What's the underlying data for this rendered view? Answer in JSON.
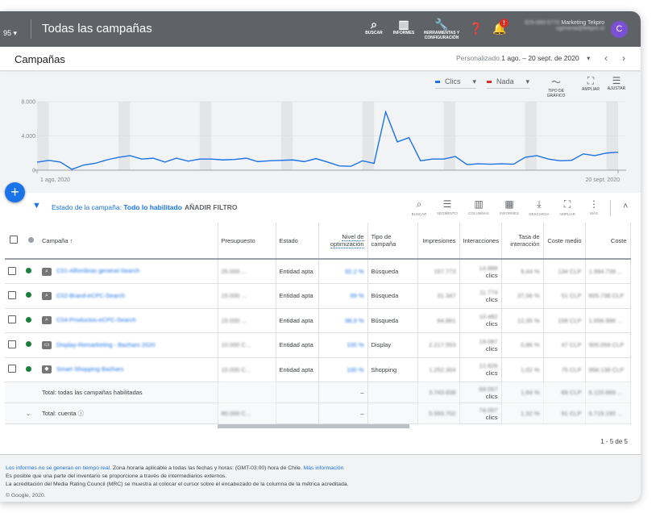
{
  "topbar": {
    "account_fragment": "95",
    "title": "Todas las campañas",
    "search": "BUSCAR",
    "reports": "INFORMES",
    "tools": "HERRAMIENTAS Y CONFIGURACIÓN",
    "notification_badge": "!",
    "phone": "929-069-5770",
    "account_name": "Marketing Tekpro",
    "email": "cgimena@tekpro.cl",
    "avatar": "C"
  },
  "header": {
    "title": "Campañas",
    "range_label": "Personalizado",
    "range": "1 ago. – 20 sept. de 2020"
  },
  "chart_controls": {
    "metric1": "Clics",
    "metric1_color": "#1a73e8",
    "metric2": "Nada",
    "metric2_color": "#d93025",
    "chart_type": "TIPO DE GRÁFICO",
    "expand": "AMPLIAR",
    "adjust": "AJUSTAR"
  },
  "chart_data": {
    "type": "line",
    "x_start": "1 ago. 2020",
    "x_end": "20 sept. 2020",
    "x_tick_labels": [
      "1 ago. 2020",
      "20 sept. 2020"
    ],
    "y_tick_labels": [
      "0",
      "4.000",
      "8.000"
    ],
    "ylim": [
      0,
      8000
    ],
    "grid": true,
    "weekend_shading": true,
    "series": [
      {
        "name": "Clics",
        "color": "#1a73e8",
        "values": [
          940,
          1150,
          950,
          100,
          600,
          800,
          1200,
          1500,
          1700,
          1300,
          1400,
          950,
          1400,
          1050,
          1300,
          1300,
          1200,
          1250,
          1400,
          1000,
          1100,
          1150,
          1200,
          1000,
          1350,
          950,
          500,
          450,
          1100,
          800,
          6800,
          3300,
          3800,
          1100,
          1300,
          1300,
          1600,
          650,
          750,
          700,
          750,
          700,
          1500,
          1700,
          1300,
          1100,
          1150,
          1900,
          1700,
          2000,
          2100
        ]
      }
    ]
  },
  "filter": {
    "label": "Estado de la campaña:",
    "value": "Todo lo habilitado",
    "add": "AÑADIR FILTRO"
  },
  "table_tools": [
    "BUSCAR",
    "SEGMENTO",
    "COLUMNAS",
    "INFORMES",
    "DESCARGA",
    "AMPLIAR",
    "MÁS"
  ],
  "columns": [
    "Campaña",
    "Presupuesto",
    "Estado",
    "Nivel de optimización",
    "Tipo de campaña",
    "Impresiones",
    "Interacciones",
    "Tasa de interacción",
    "Coste medio",
    "Coste"
  ],
  "rows": [
    {
      "icon": "search",
      "name": "C01-Alfombras general-Search",
      "budget": "25.000 ...",
      "status": "Entidad apta",
      "opt": "92,2 %",
      "type": "Búsqueda",
      "impr": "157.773",
      "inter": "14.888",
      "inter_unit": "clics",
      "rate": "9,44 %",
      "cpc": "134 CLP",
      "cost": "1.994.739 ..."
    },
    {
      "icon": "search",
      "name": "C02-Brand-eCPC-Search",
      "budget": "15.000 ...",
      "status": "Entidad apta",
      "opt": "99 %",
      "type": "Búsqueda",
      "impr": "31.347",
      "inter": "11.774",
      "inter_unit": "clics",
      "rate": "37,56 %",
      "cpc": "51 CLP",
      "cost": "605.738 CLP"
    },
    {
      "icon": "search",
      "name": "C04-Productos-eCPC-Search",
      "budget": "15.000 ...",
      "status": "Entidad apta",
      "opt": "98,9 %",
      "type": "Búsqueda",
      "impr": "84.861",
      "inter": "10.482",
      "inter_unit": "clics",
      "rate": "12,35 %",
      "cpc": "158 CLP",
      "cost": "1.656.996 ..."
    },
    {
      "icon": "display",
      "name": "Display-Remarketing - Bazhars 2020",
      "budget": "10.000 C...",
      "status": "Entidad apta",
      "opt": "100 %",
      "type": "Display",
      "impr": "2.217.553",
      "inter": "19.087",
      "inter_unit": "clics",
      "rate": "0,86 %",
      "cpc": "47 CLP",
      "cost": "905.058 CLP"
    },
    {
      "icon": "tag",
      "name": "Smart Shopping Bazhars",
      "budget": "15.000 C...",
      "status": "Entidad apta",
      "opt": "100 %",
      "type": "Shopping",
      "impr": "1.252.304",
      "inter": "12.826",
      "inter_unit": "clics",
      "rate": "1,02 %",
      "cpc": "75 CLP",
      "cost": "958.138 CLP"
    }
  ],
  "totals": [
    {
      "label": "Total: todas las campañas habilitadas",
      "budget": "",
      "opt": "–",
      "impr": "3.743.838",
      "inter": "69.057",
      "inter_unit": "clics",
      "rate": "1,84 %",
      "cpc": "89 CLP",
      "cost": "6.120.669 ..."
    },
    {
      "label": "Total: cuenta",
      "budget": "80.000 C...",
      "opt": "–",
      "impr": "5.593.702",
      "inter": "74.007",
      "inter_unit": "clics",
      "rate": "1,32 %",
      "cpc": "91 CLP",
      "cost": "6.719.190 ..."
    }
  ],
  "pagination": "1 - 5 de 5",
  "footer": {
    "link1": "Los informes no se generan en tiempo real.",
    "text1": " Zona horaria aplicable a todas las fechas y horas: (GMT-03:00) hora de Chile. ",
    "link2": "Más información",
    "line2": "Es posible que una parte del inventario se proporcione a través de intermediarios externos.",
    "line3": "La acreditación del Media Rating Council (MRC) se muestra al colocar el cursor sobre el encabezado de la columna de la métrica acreditada.",
    "copyright": "© Google, 2020."
  }
}
